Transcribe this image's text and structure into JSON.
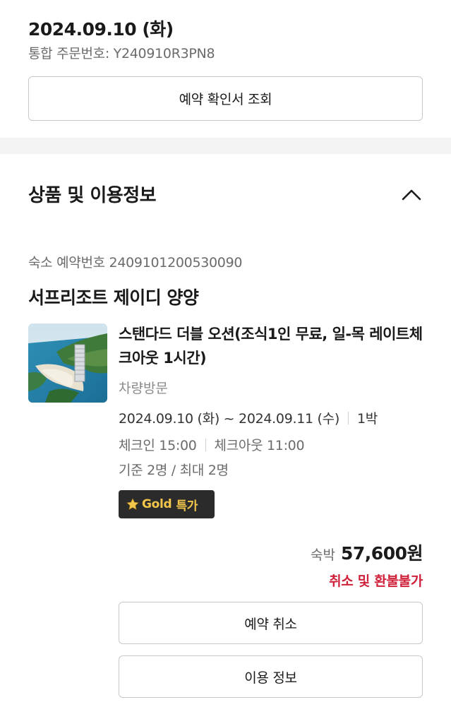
{
  "order": {
    "date": "2024.09.10 (화)",
    "number_text": "통합 주문번호: Y240910R3PN8",
    "confirm_button": "예약 확인서 조회"
  },
  "section": {
    "title": "상품 및 이용정보"
  },
  "booking": {
    "stay_number_text": "숙소 예약번호 2409101200530090",
    "hotel_name": "서프리조트 제이디 양양",
    "room_name": "스탠다드 더블 오션(조식1인 무료, 일-목 레이트체크아웃 1시간)",
    "visit_type": "차량방문",
    "stay_dates": "2024.09.10 (화) ~ 2024.09.11 (수)",
    "nights": "1박",
    "checkin": "체크인 15:00",
    "checkout": "체크아웃 11:00",
    "capacity": "기준 2명 / 최대 2명",
    "badge_brand": "Gold",
    "badge_label": "특가",
    "badge_icon": "star-icon",
    "price_label": "숙박",
    "price_value": "57,600원",
    "refund_note": "취소 및 환불불가",
    "cancel_button": "예약 취소",
    "usage_button": "이용 정보"
  },
  "colors": {
    "accent_red": "#d0213b",
    "badge_bg": "#2b2b2b",
    "badge_gold": "#f3c64b",
    "band": "#f4f4f4"
  }
}
